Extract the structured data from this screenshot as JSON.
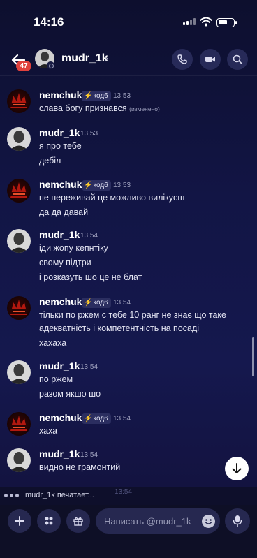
{
  "status_bar": {
    "time": "14:16"
  },
  "header": {
    "unread_badge": "47",
    "contact_name": "mudr_1k",
    "icons": [
      "arrow-left-icon",
      "phone-icon",
      "video-icon",
      "search-icon",
      "chevron-right-icon"
    ]
  },
  "messages": [
    {
      "author": "nemchuk",
      "tag": "код6",
      "time": "13:53",
      "lines": [
        "слава богу признався"
      ],
      "edited": "(изменено)"
    },
    {
      "author": "mudr_1k",
      "time": "13:53",
      "lines": [
        "я про тебе",
        "дебіл"
      ]
    },
    {
      "author": "nemchuk",
      "tag": "код6",
      "time": "13:53",
      "lines": [
        "не переживай це можливо вилікуєш",
        "да да давай"
      ]
    },
    {
      "author": "mudr_1k",
      "time": "13:54",
      "lines": [
        "іди жопу кепнтіку",
        "свому підтри",
        "і розказуть шо це не блат"
      ]
    },
    {
      "author": "nemchuk",
      "tag": "код6",
      "time": "13:54",
      "lines": [
        "тільки по ржем с тебе 10 ранг не знає що таке",
        "адекватність і компетентність на посаді",
        "хахаха"
      ]
    },
    {
      "author": "mudr_1k",
      "time": "13:54",
      "lines": [
        "по ржем",
        "разом якшо шо"
      ]
    },
    {
      "author": "nemchuk",
      "tag": "код6",
      "time": "13:54",
      "lines": [
        "хаха"
      ]
    },
    {
      "author": "mudr_1k",
      "time": "13:54",
      "lines": [
        "видно не грамонтий"
      ]
    }
  ],
  "typing": {
    "text": "mudr_1k печатает...",
    "partial_time": "13:54"
  },
  "composer": {
    "placeholder": "Написать @mudr_1k",
    "icons": [
      "plus-icon",
      "apps-icon",
      "gift-icon",
      "emoji-icon",
      "microphone-icon"
    ]
  },
  "colors": {
    "background": "#121545",
    "badge": "#e0413d",
    "tag_bolt": "#f5c518"
  }
}
